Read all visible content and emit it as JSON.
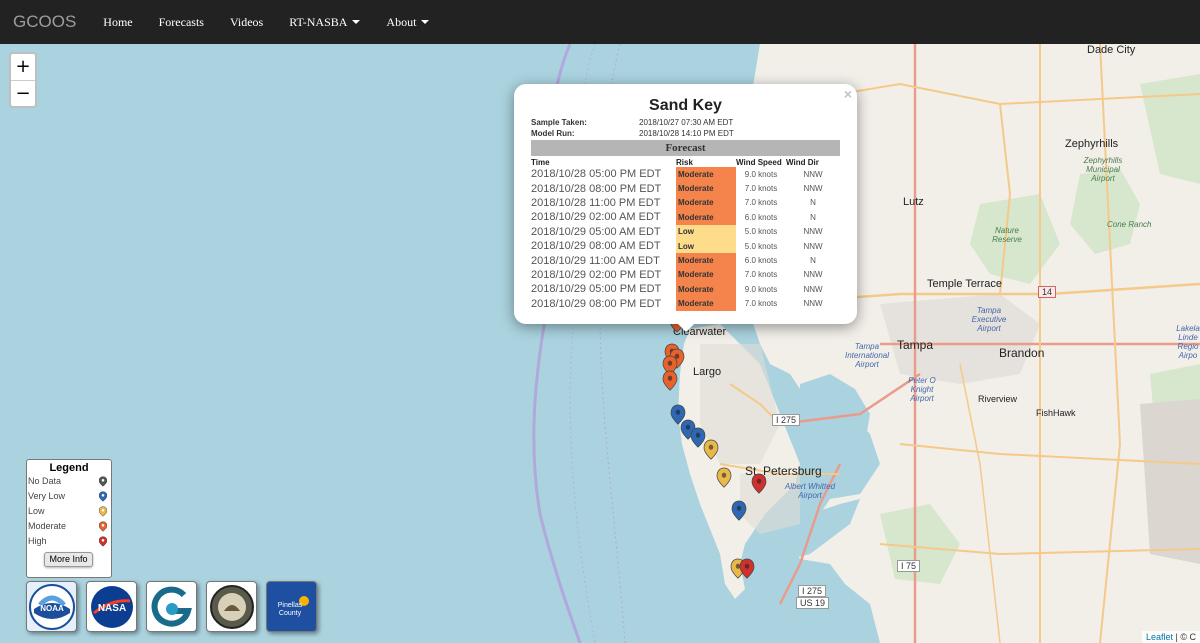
{
  "nav": {
    "brand": "GCOOS",
    "items": [
      {
        "label": "Home",
        "dropdown": false
      },
      {
        "label": "Forecasts",
        "dropdown": false
      },
      {
        "label": "Videos",
        "dropdown": false
      },
      {
        "label": "RT-NASBA",
        "dropdown": true
      },
      {
        "label": "About",
        "dropdown": true
      }
    ]
  },
  "zoom": {
    "in": "+",
    "out": "−"
  },
  "map_labels": {
    "dade_city": "Dade City",
    "zephyrhills": "Zephyrhills",
    "zephyrhills_airport": "Zephyrhills Municipal Airport",
    "lutz": "Lutz",
    "nature_reserve": "Nature Reserve",
    "cone_ranch": "Cone Ranch",
    "temple_terrace": "Temple Terrace",
    "tampa_exec": "Tampa Executive Airport",
    "lakeland": "Lakela Linde Regio Airpo",
    "tampa_intl": "Tampa International Airport",
    "tampa": "Tampa",
    "brandon": "Brandon",
    "clearwater": "Clearwater",
    "largo": "Largo",
    "peter_o_knight": "Peter O Knight Airport",
    "riverview": "Riverview",
    "fishhawk": "FishHawk",
    "st_pete": "St. Petersburg",
    "albert_whitted": "Albert Whitted Airport",
    "i275_a": "I 275",
    "i275_b": "I 275",
    "us19": "US 19",
    "i75": "I 75",
    "route14": "14"
  },
  "popup": {
    "title": "Sand Key",
    "close": "×",
    "sample_label": "Sample Taken:",
    "sample_value": "2018/10/27 07:30 AM EDT",
    "model_label": "Model Run:",
    "model_value": "2018/10/28 14:10 PM EDT",
    "forecast_header": "Forecast",
    "columns": [
      "Time",
      "Risk",
      "Wind Speed",
      "Wind Dir"
    ],
    "rows": [
      {
        "time": "2018/10/28 05:00 PM EDT",
        "risk": "Moderate",
        "speed": "9.0 knots",
        "dir": "NNW"
      },
      {
        "time": "2018/10/28 08:00 PM EDT",
        "risk": "Moderate",
        "speed": "7.0 knots",
        "dir": "NNW"
      },
      {
        "time": "2018/10/28 11:00 PM EDT",
        "risk": "Moderate",
        "speed": "7.0 knots",
        "dir": "N"
      },
      {
        "time": "2018/10/29 02:00 AM EDT",
        "risk": "Moderate",
        "speed": "6.0 knots",
        "dir": "N"
      },
      {
        "time": "2018/10/29 05:00 AM EDT",
        "risk": "Low",
        "speed": "5.0 knots",
        "dir": "NNW"
      },
      {
        "time": "2018/10/29 08:00 AM EDT",
        "risk": "Low",
        "speed": "5.0 knots",
        "dir": "NNW"
      },
      {
        "time": "2018/10/29 11:00 AM EDT",
        "risk": "Moderate",
        "speed": "6.0 knots",
        "dir": "N"
      },
      {
        "time": "2018/10/29 02:00 PM EDT",
        "risk": "Moderate",
        "speed": "7.0 knots",
        "dir": "NNW"
      },
      {
        "time": "2018/10/29 05:00 PM EDT",
        "risk": "Moderate",
        "speed": "9.0 knots",
        "dir": "NNW"
      },
      {
        "time": "2018/10/29 08:00 PM EDT",
        "risk": "Moderate",
        "speed": "7.0 knots",
        "dir": "NNW"
      }
    ]
  },
  "risk_colors": {
    "Moderate": "#f4844c",
    "Low": "#fddc8c",
    "High": "#d0312d",
    "Very Low": "#2e68b5",
    "No Data": "#555555"
  },
  "legend": {
    "title": "Legend",
    "items": [
      {
        "label": "No Data",
        "color": "#555555"
      },
      {
        "label": "Very Low",
        "color": "#2e68b5"
      },
      {
        "label": "Low",
        "color": "#e8b84a"
      },
      {
        "label": "Moderate",
        "color": "#e8622c"
      },
      {
        "label": "High",
        "color": "#d0312d"
      }
    ],
    "button": "More Info"
  },
  "logos": [
    {
      "name": "noaa",
      "text": "NOAA"
    },
    {
      "name": "nasa",
      "text": "NASA"
    },
    {
      "name": "gcoos",
      "text": "G"
    },
    {
      "name": "seal",
      "text": ""
    },
    {
      "name": "pinellas",
      "text": "Pinellas County"
    }
  ],
  "attribution": {
    "link": "Leaflet",
    "rest": " | © C"
  },
  "markers": [
    {
      "risk": "Moderate"
    },
    {
      "risk": "Moderate"
    },
    {
      "risk": "Moderate"
    },
    {
      "risk": "Moderate"
    },
    {
      "risk": "Moderate"
    },
    {
      "risk": "Very Low"
    },
    {
      "risk": "Very Low"
    },
    {
      "risk": "Very Low"
    },
    {
      "risk": "Low"
    },
    {
      "risk": "Low"
    },
    {
      "risk": "High"
    },
    {
      "risk": "Very Low"
    },
    {
      "risk": "Low"
    },
    {
      "risk": "High"
    }
  ]
}
